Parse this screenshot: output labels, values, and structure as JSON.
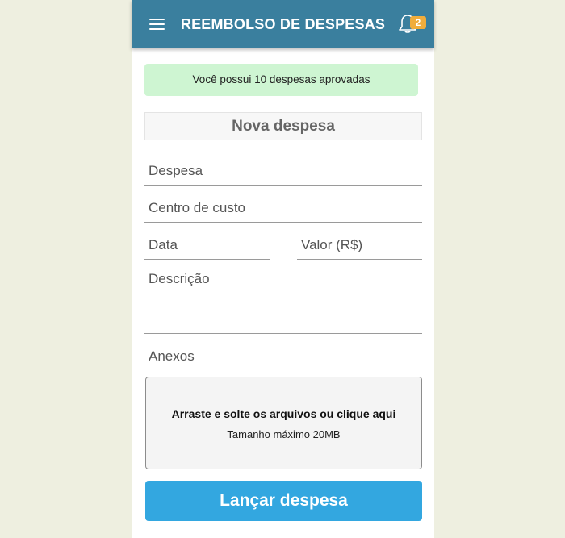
{
  "header": {
    "title": "REEMBOLSO DE DESPESAS",
    "menu_icon": "hamburger-menu-icon",
    "notification_icon": "bell-icon",
    "notification_count": "2"
  },
  "alert": {
    "text": "Você possui 10 despesas aprovadas"
  },
  "form": {
    "section_title": "Nova despesa",
    "fields": {
      "despesa": {
        "placeholder": "Despesa",
        "value": ""
      },
      "centro_custo": {
        "placeholder": "Centro de custo",
        "value": ""
      },
      "data": {
        "placeholder": "Data",
        "value": ""
      },
      "valor": {
        "placeholder": "Valor (R$)",
        "value": ""
      },
      "descricao": {
        "placeholder": "Descrição",
        "value": ""
      }
    },
    "attachments": {
      "label": "Anexos",
      "dropzone_text": "Arraste e solte os arquivos ou clique aqui",
      "max_size_text": "Tamanho máximo 20MB"
    },
    "submit_label": "Lançar despesa"
  },
  "colors": {
    "topbar": "#3a7f9e",
    "badge": "#f0ad3c",
    "alert_bg": "#cef5d2",
    "button": "#33a7e0",
    "page_bg": "#eeefe0"
  }
}
